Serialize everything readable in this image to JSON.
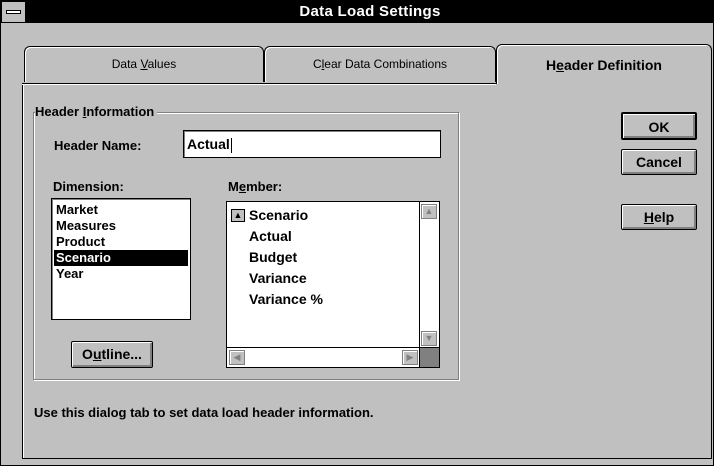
{
  "window": {
    "title": "Data Load Settings"
  },
  "tabs": [
    {
      "pre": "Data ",
      "mn": "V",
      "post": "alues"
    },
    {
      "pre": "C",
      "mn": "l",
      "post": "ear Data Combinations"
    },
    {
      "pre": "H",
      "mn": "e",
      "post": "ader Definition"
    }
  ],
  "group": {
    "pre": "Header ",
    "mn": "I",
    "post": "nformation"
  },
  "header_name": {
    "label": "Header Name:",
    "value": "Actual"
  },
  "dimension": {
    "label": "Dimension:",
    "items": [
      "Market",
      "Measures",
      "Product",
      "Scenario",
      "Year"
    ],
    "selected": "Scenario"
  },
  "member": {
    "label_pre": "M",
    "label_mn": "e",
    "label_post": "mber:",
    "parent": "Scenario",
    "items": [
      "Actual",
      "Budget",
      "Variance",
      "Variance %"
    ]
  },
  "buttons": {
    "ok": "OK",
    "cancel": "Cancel",
    "help_mn": "H",
    "help_post": "elp",
    "outline_pre": "O",
    "outline_mn": "u",
    "outline_post": "tline..."
  },
  "status_text": "Use this dialog tab to set data load header information."
}
